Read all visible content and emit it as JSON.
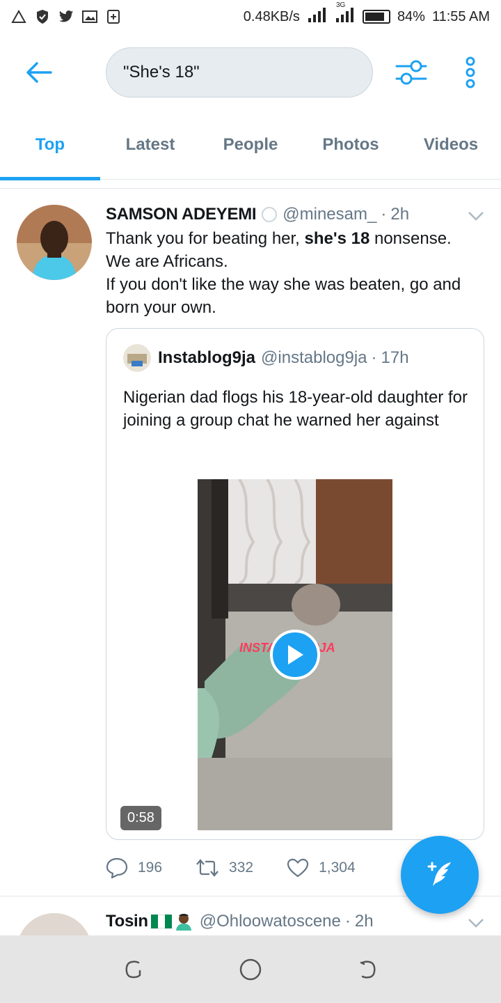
{
  "status_bar": {
    "net_speed": "0.48KB/s",
    "network_tag": "3G",
    "battery": "84%",
    "battery_level": 0.84,
    "time": "11:55 AM"
  },
  "search": {
    "query": "\"She's 18\""
  },
  "tabs": [
    {
      "label": "Top",
      "active": true
    },
    {
      "label": "Latest",
      "active": false
    },
    {
      "label": "People",
      "active": false
    },
    {
      "label": "Photos",
      "active": false
    },
    {
      "label": "Videos",
      "active": false
    }
  ],
  "tweet": {
    "name": "SAMSON ADEYEMI",
    "handle": "@minesam_",
    "dot": "·",
    "time": "2h",
    "body_line1_pre": "Thank you for beating her, ",
    "body_line1_bold": "she's 18",
    "body_line1_post": " nonsense.",
    "body_line2": "We are Africans.",
    "body_line3": "If you don't like the way she was beaten, go and born your own.",
    "quote": {
      "name": "Instablog9ja",
      "handle": "@instablog9ja",
      "dot": "·",
      "time": "17h",
      "body": "Nigerian dad flogs his 18-year-old daughter for joining a group chat he warned her against",
      "video_duration": "0:58",
      "watermark": "INSTABLOG9JA"
    },
    "actions": {
      "replies": "196",
      "retweets": "332",
      "likes": "1,304"
    }
  },
  "tweet2": {
    "name": "Tosin",
    "handle": "@Ohloowatoscene",
    "dot": "·",
    "time": "2h"
  },
  "colors": {
    "accent": "#1da1f2",
    "secondary_text": "#657786",
    "border": "#e1e8ed"
  }
}
